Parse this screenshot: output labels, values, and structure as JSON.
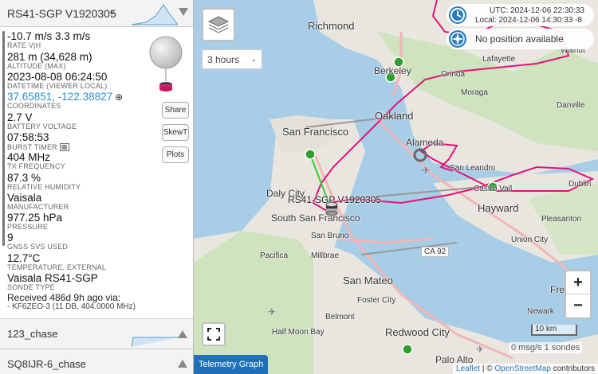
{
  "sonde": {
    "callsign": "RS41-SGP V1920305",
    "rate": {
      "value": "-10.7 m/s 3.3 m/s",
      "label": "RATE V|H"
    },
    "altitude": {
      "value": "281 m (34,628 m)",
      "label": "ALTITUDE (MAX)"
    },
    "datetime": {
      "value": "2023-08-08 06:24:50",
      "label": "DATETIME (VIEWER LOCAL)"
    },
    "coordinates": {
      "value": "37.65851, -122.38827",
      "label": "COORDINATES"
    },
    "battery": {
      "value": "2.7 V",
      "label": "BATTERY VOLTAGE"
    },
    "burst_timer": {
      "value": "07:58:53",
      "label": "BURST TIMER"
    },
    "tx_frequency": {
      "value": "404 MHz",
      "label": "TX FREQUENCY"
    },
    "humidity": {
      "value": "87.3 %",
      "label": "RELATIVE HUMIDITY"
    },
    "manufacturer": {
      "value": "Vaisala",
      "label": "MANUFACTURER"
    },
    "pressure": {
      "value": "977.25 hPa",
      "label": "PRESSURE"
    },
    "gnss_svs": {
      "value": "9",
      "label": "GNSS SVS USED"
    },
    "temperature": {
      "value": "12.7°C",
      "label": "TEMPERATURE, EXTERNAL"
    },
    "sonde_type": {
      "value": "Vaisala RS41-SGP",
      "label": "SONDE TYPE"
    },
    "received": "Received 486d 9h ago via:",
    "received_by": "- KF6ZEO-3 (11 DB, 404.0000 MHz)"
  },
  "buttons": {
    "share": "Share",
    "skewt": "SkewT",
    "plots": "Plots"
  },
  "groups": [
    "123_chase",
    "SQ8IJR-6_chase"
  ],
  "map": {
    "time_range": "3 hours",
    "utc": "UTC: 2024-12-06 22:30:33",
    "local": "Local: 2024-12-06 14:30:33 -8",
    "position": "No position available",
    "zoom_in": "+",
    "zoom_out": "−",
    "scale": "10 km",
    "rate": "0 msg/s 1 sondes",
    "telemetry_graph": "Telemetry Graph",
    "track_label": "RS41-SGP V1920305",
    "attribution_leaflet": "Leaflet",
    "attribution_sep": " | © ",
    "attribution_osm": "OpenStreetMap",
    "attribution_rest": " contributors",
    "places": {
      "richmond": "Richmond",
      "berkeley": "Berkeley",
      "oakland": "Oakland",
      "alameda": "Alameda",
      "san_francisco": "San Francisco",
      "daly_city": "Daly City",
      "south_sf": "South San Francisco",
      "san_bruno": "San Bruno",
      "pacifica": "Pacifica",
      "millbrae": "Millbrae",
      "san_mateo": "San Mateo",
      "redwood_city": "Redwood City",
      "palo_alto": "Palo Alto",
      "hayward": "Hayward",
      "san_leandro": "San Leandro",
      "castro_valley": "Castro Vall",
      "dublin": "Dublin",
      "fremont": "Fremont",
      "union_city": "Union City",
      "lafayette": "Lafayette",
      "danville": "Danville",
      "walnut_creek": "Walnut",
      "orinda": "Orinda",
      "moraga": "Moraga",
      "pleasanton": "Pleasanton",
      "newark": "Newark",
      "foster_city": "Foster City",
      "belmont": "Belmont",
      "half_moon_bay": "Half Moon Bay",
      "ca92": "CA 92"
    }
  },
  "colors": {
    "track": "#e0147a",
    "accent": "#2b7bbf",
    "marker": "#2e9e2e"
  }
}
